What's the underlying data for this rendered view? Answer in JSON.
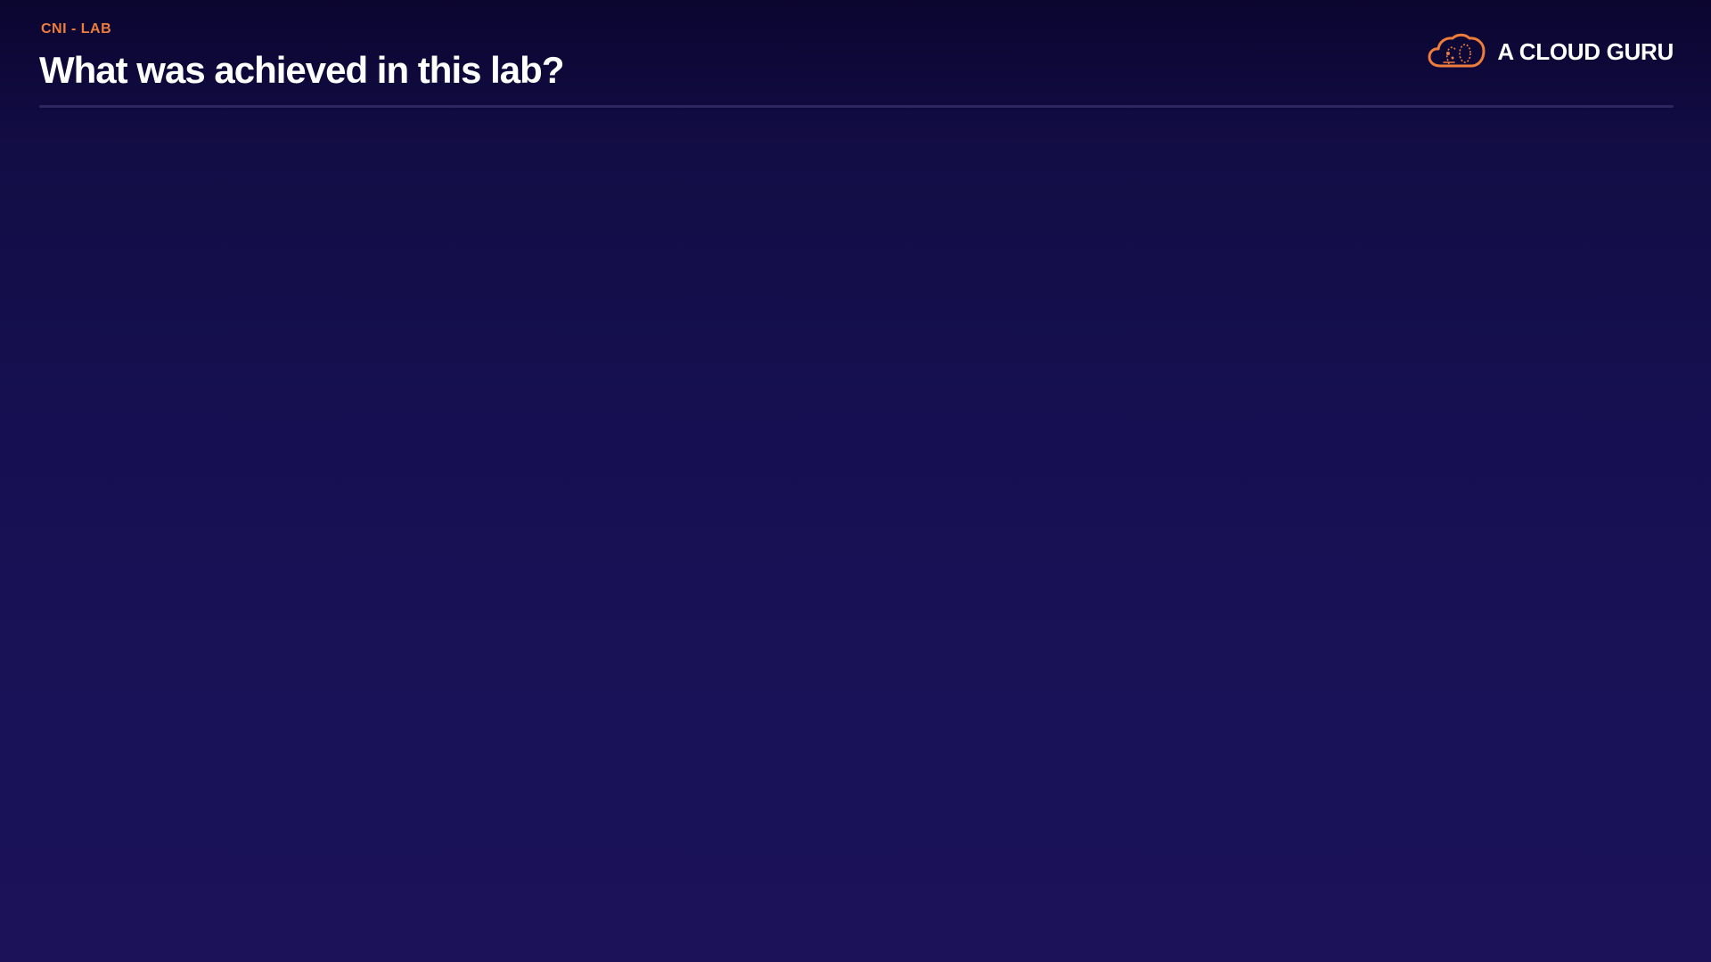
{
  "header": {
    "eyebrow": "CNI - LAB",
    "title": "What was achieved in this lab?"
  },
  "brand": {
    "name": "A CLOUD GURU",
    "icon": "cloud-guru-logo-icon"
  },
  "colors": {
    "accent": "#ee7d3b",
    "background_top": "#0b0530",
    "background_bottom": "#1b1259",
    "divider": "#2c2760",
    "title_text": "#ffffff"
  }
}
